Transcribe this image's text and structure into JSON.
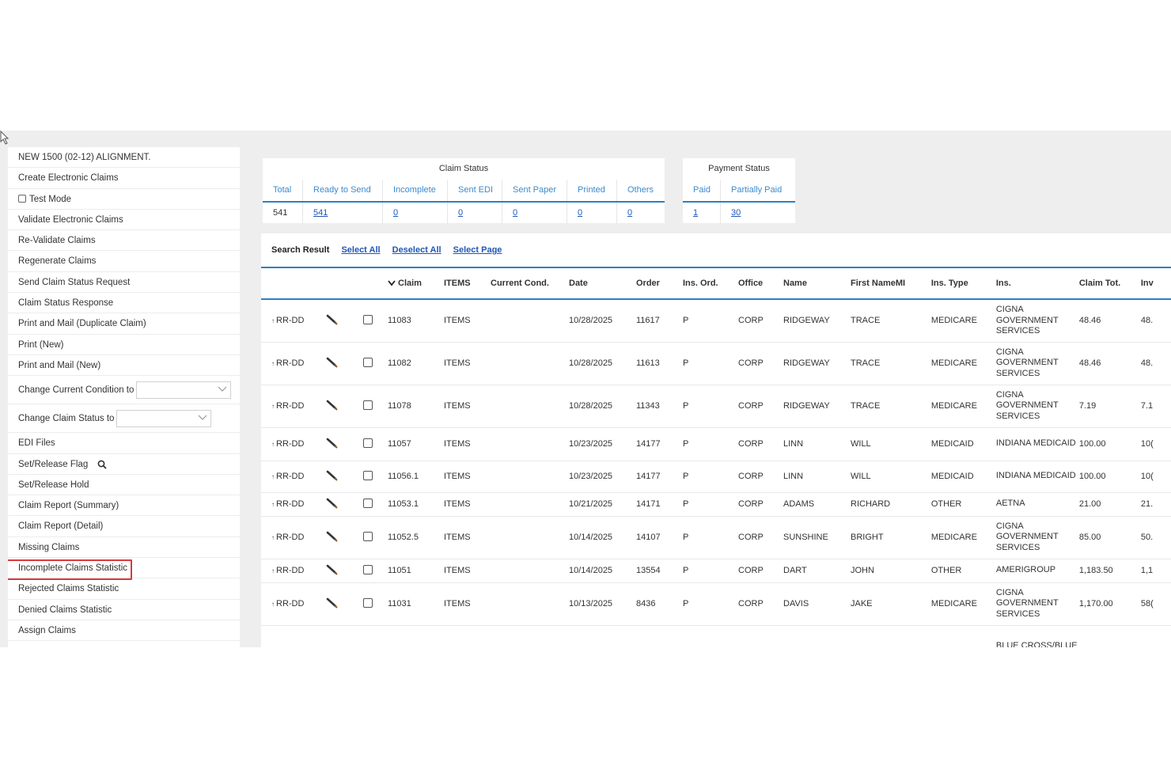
{
  "sidebar": {
    "items": [
      {
        "label": "NEW 1500 (02-12) ALIGNMENT."
      },
      {
        "label": "Create Electronic Claims"
      },
      {
        "label": "Test Mode"
      },
      {
        "label": "Validate Electronic Claims"
      },
      {
        "label": "Re-Validate Claims"
      },
      {
        "label": "Regenerate Claims"
      },
      {
        "label": "Send Claim Status Request"
      },
      {
        "label": "Claim Status Response"
      },
      {
        "label": "Print and Mail (Duplicate Claim)"
      },
      {
        "label": "Print (New)"
      },
      {
        "label": "Print and Mail (New)"
      },
      {
        "label": "Change Current Condition to"
      },
      {
        "label": "Change Claim Status to"
      },
      {
        "label": "EDI Files"
      },
      {
        "label": "Set/Release Flag"
      },
      {
        "label": "Set/Release Hold"
      },
      {
        "label": "Claim Report (Summary)"
      },
      {
        "label": "Claim Report (Detail)"
      },
      {
        "label": "Missing Claims"
      },
      {
        "label": "Incomplete Claims Statistic"
      },
      {
        "label": "Rejected Claims Statistic"
      },
      {
        "label": "Denied Claims Statistic"
      },
      {
        "label": "Assign Claims"
      }
    ]
  },
  "claim_status": {
    "title": "Claim Status",
    "headers": [
      "Total",
      "Ready to Send",
      "Incomplete",
      "Sent EDI",
      "Sent Paper",
      "Printed",
      "Others"
    ],
    "values": [
      "541",
      "541",
      "0",
      "0",
      "0",
      "0",
      "0"
    ]
  },
  "payment_status": {
    "title": "Payment Status",
    "headers": [
      "Paid",
      "Partially Paid"
    ],
    "values": [
      "1",
      "30"
    ]
  },
  "results": {
    "search_result_label": "Search Result",
    "select_all": "Select All",
    "deselect_all": "Deselect All",
    "select_page": "Select Page",
    "columns": [
      "Claim",
      "ITEMS",
      "Current Cond.",
      "Date",
      "Order",
      "Ins. Ord.",
      "Office",
      "Name",
      "First Name",
      "MI",
      "Ins. Type",
      "Ins.",
      "Claim Tot.",
      "Inv"
    ],
    "rows": [
      {
        "status": "RR-DD",
        "claim": "11083",
        "items": "ITEMS",
        "cond": "",
        "date": "10/28/2025",
        "order": "11617",
        "ins_ord": "P",
        "office": "CORP",
        "name": "RIDGEWAY",
        "first": "TRACE",
        "mi": "",
        "ins_type": "MEDICARE",
        "ins": "CIGNA GOVERNMENT SERVICES",
        "claim_tot": "48.46",
        "inv": "48."
      },
      {
        "status": "RR-DD",
        "claim": "11082",
        "items": "ITEMS",
        "cond": "",
        "date": "10/28/2025",
        "order": "11613",
        "ins_ord": "P",
        "office": "CORP",
        "name": "RIDGEWAY",
        "first": "TRACE",
        "mi": "",
        "ins_type": "MEDICARE",
        "ins": "CIGNA GOVERNMENT SERVICES",
        "claim_tot": "48.46",
        "inv": "48."
      },
      {
        "status": "RR-DD",
        "claim": "11078",
        "items": "ITEMS",
        "cond": "",
        "date": "10/28/2025",
        "order": "11343",
        "ins_ord": "P",
        "office": "CORP",
        "name": "RIDGEWAY",
        "first": "TRACE",
        "mi": "",
        "ins_type": "MEDICARE",
        "ins": "CIGNA GOVERNMENT SERVICES",
        "claim_tot": "7.19",
        "inv": "7.1"
      },
      {
        "status": "RR-DD",
        "claim": "11057",
        "items": "ITEMS",
        "cond": "",
        "date": "10/23/2025",
        "order": "14177",
        "ins_ord": "P",
        "office": "CORP",
        "name": "LINN",
        "first": "WILL",
        "mi": "",
        "ins_type": "MEDICAID",
        "ins": "INDIANA MEDICAID",
        "claim_tot": "100.00",
        "inv": "10("
      },
      {
        "status": "RR-DD",
        "claim": "11056.1",
        "items": "ITEMS",
        "cond": "",
        "date": "10/23/2025",
        "order": "14177",
        "ins_ord": "P",
        "office": "CORP",
        "name": "LINN",
        "first": "WILL",
        "mi": "",
        "ins_type": "MEDICAID",
        "ins": "INDIANA MEDICAID",
        "claim_tot": "100.00",
        "inv": "10("
      },
      {
        "status": "RR-DD",
        "claim": "11053.1",
        "items": "ITEMS",
        "cond": "",
        "date": "10/21/2025",
        "order": "14171",
        "ins_ord": "P",
        "office": "CORP",
        "name": "ADAMS",
        "first": "RICHARD",
        "mi": "",
        "ins_type": "OTHER",
        "ins": "AETNA",
        "claim_tot": "21.00",
        "inv": "21."
      },
      {
        "status": "RR-DD",
        "claim": "11052.5",
        "items": "ITEMS",
        "cond": "",
        "date": "10/14/2025",
        "order": "14107",
        "ins_ord": "P",
        "office": "CORP",
        "name": "SUNSHINE",
        "first": "BRIGHT",
        "mi": "",
        "ins_type": "MEDICARE",
        "ins": "CIGNA GOVERNMENT SERVICES",
        "claim_tot": "85.00",
        "inv": "50."
      },
      {
        "status": "RR-DD",
        "claim": "11051",
        "items": "ITEMS",
        "cond": "",
        "date": "10/14/2025",
        "order": "13554",
        "ins_ord": "P",
        "office": "CORP",
        "name": "DART",
        "first": "JOHN",
        "mi": "",
        "ins_type": "OTHER",
        "ins": "AMERIGROUP",
        "claim_tot": "1,183.50",
        "inv": "1,1"
      },
      {
        "status": "RR-DD",
        "claim": "11031",
        "items": "ITEMS",
        "cond": "",
        "date": "10/13/2025",
        "order": "8436",
        "ins_ord": "P",
        "office": "CORP",
        "name": "DAVIS",
        "first": "JAKE",
        "mi": "",
        "ins_type": "MEDICARE",
        "ins": "CIGNA GOVERNMENT SERVICES",
        "claim_tot": "1,170.00",
        "inv": "58("
      },
      {
        "status": "",
        "claim": "",
        "items": "",
        "cond": "",
        "date": "",
        "order": "",
        "ins_ord": "",
        "office": "",
        "name": "",
        "first": "",
        "mi": "",
        "ins_type": "",
        "ins": "BLUE CROSS/BLUE",
        "claim_tot": "",
        "inv": ""
      }
    ]
  },
  "colors": {
    "accent_blue": "#2f7fc1",
    "link_blue": "#1f57b8",
    "highlight_red": "#d9393d",
    "background": "#eeeeee"
  }
}
